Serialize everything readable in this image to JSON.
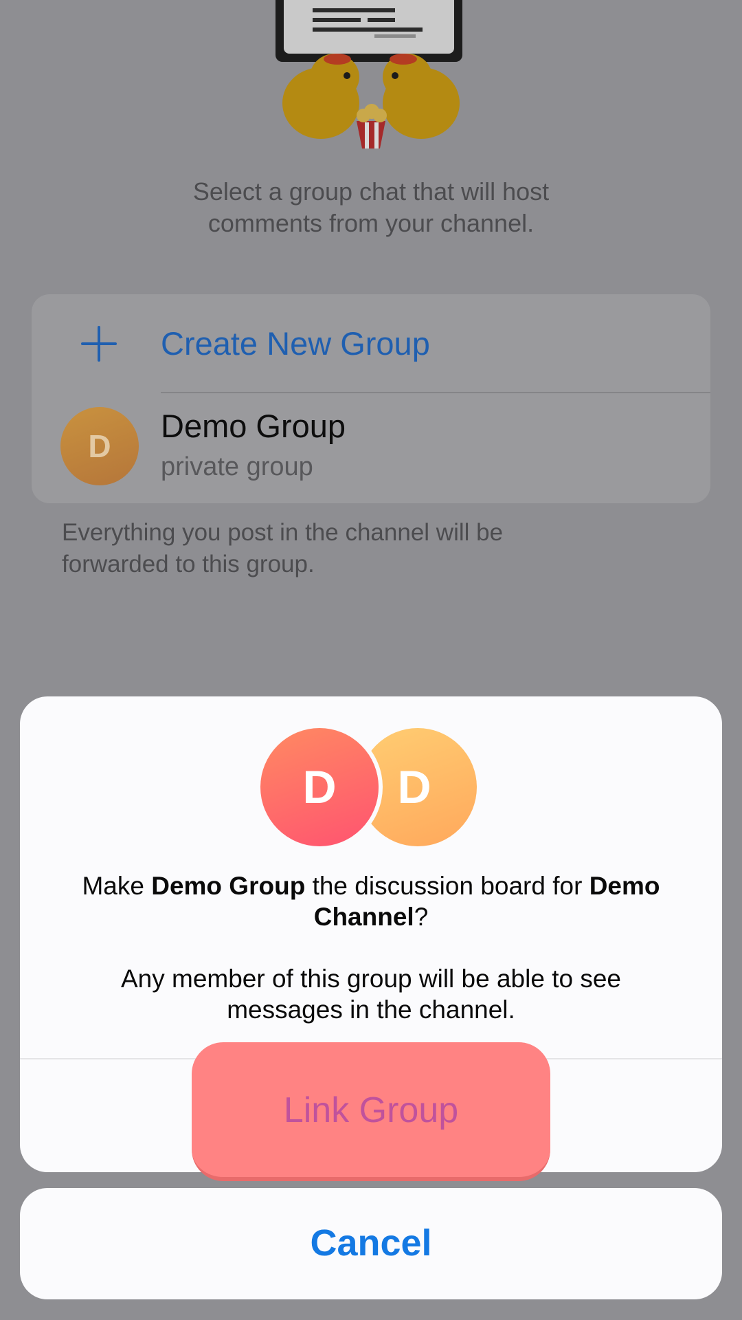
{
  "background": {
    "description_lines": [
      "Select a group chat that will host",
      "comments from your channel."
    ],
    "create_group_label": "Create New Group",
    "group": {
      "avatar_initial": "D",
      "name": "Demo Group",
      "type": "private group"
    },
    "footer_lines": [
      "Everything you post in the channel will be",
      "forwarded to this group."
    ]
  },
  "sheet": {
    "group_avatar_initial": "D",
    "channel_avatar_initial": "D",
    "message": {
      "line1_prefix": "Make ",
      "line1_group": "Demo Group",
      "line1_middle": " the discussion board for ",
      "line1_channel_part1": "Demo",
      "line2_channel_part2": "Channel",
      "line2_suffix": "?",
      "detail_line1": "Any member of this group will be able to see",
      "detail_line2": "messages in the channel."
    },
    "link_button_label": "Link Group",
    "cancel_button_label": "Cancel"
  },
  "colors": {
    "accent_blue": "#1479e3",
    "link_highlight": "#ff8383",
    "avatar_group_gradient": [
      "#ff8a62",
      "#ff5370"
    ],
    "avatar_channel_gradient": [
      "#ffcd72",
      "#ffa85c"
    ]
  },
  "icons": {
    "sticker": "ducks-with-popcorn-sticker",
    "create": "plus-icon"
  }
}
